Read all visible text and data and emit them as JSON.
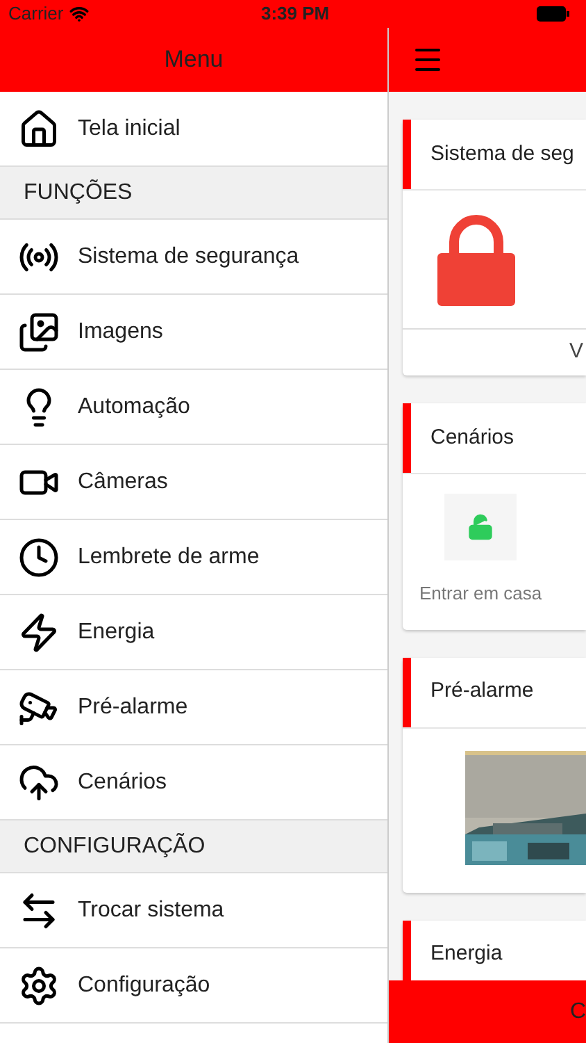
{
  "status_bar": {
    "carrier": "Carrier",
    "time": "3:39 PM"
  },
  "menu": {
    "title": "Menu",
    "items": [
      {
        "kind": "item",
        "label": "Tela inicial"
      },
      {
        "kind": "header",
        "label": "FUNÇÕES"
      },
      {
        "kind": "item",
        "label": "Sistema de segurança"
      },
      {
        "kind": "item",
        "label": "Imagens"
      },
      {
        "kind": "item",
        "label": "Automação"
      },
      {
        "kind": "item",
        "label": "Câmeras"
      },
      {
        "kind": "item",
        "label": "Lembrete de arme"
      },
      {
        "kind": "item",
        "label": "Energia"
      },
      {
        "kind": "item",
        "label": "Pré-alarme"
      },
      {
        "kind": "item",
        "label": "Cenários"
      },
      {
        "kind": "header",
        "label": "CONFIGURAÇÃO"
      },
      {
        "kind": "item",
        "label": "Trocar sistema"
      },
      {
        "kind": "item",
        "label": "Configuração"
      }
    ]
  },
  "cards": [
    {
      "kind": "lock",
      "title": "Sistema de seg",
      "footer": "V"
    },
    {
      "kind": "scenes",
      "title": "Cenários",
      "scenes": [
        {
          "label": "Entrar em casa"
        }
      ]
    },
    {
      "kind": "picture",
      "title": "Pré-alarme"
    },
    {
      "kind": "empty",
      "title": "Energia"
    }
  ],
  "bottom_button": "C"
}
